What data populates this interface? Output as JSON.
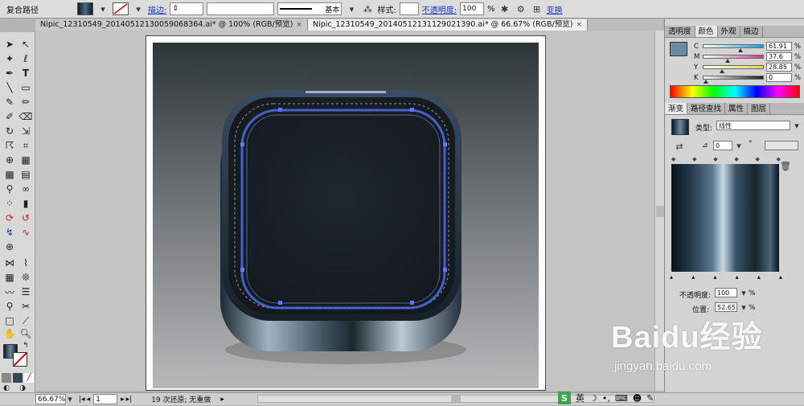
{
  "control_bar": {
    "object_type": "复合路径",
    "stroke_label": "描边:",
    "brush_label": "基本",
    "style_label": "样式:",
    "opacity_label": "不透明度:",
    "opacity_value": "100",
    "opacity_unit": "%",
    "transform_label": "变换"
  },
  "tabs": [
    {
      "label": "Nipic_12310549_20140512130059068364.ai* @ 100% (RGB/预览)",
      "close": "×",
      "active": false
    },
    {
      "label": "Nipic_12310549_20140512131129021390.ai* @ 66.67% (RGB/预览)",
      "close": "×",
      "active": true
    }
  ],
  "color_panel": {
    "tabs": [
      "透明度",
      "颜色",
      "外观",
      "描边"
    ],
    "channels": [
      {
        "name": "C",
        "value": "61.91",
        "unit": "%",
        "level": 0.62,
        "color": "#1ea0d8"
      },
      {
        "name": "M",
        "value": "37.6",
        "unit": "%",
        "level": 0.38,
        "color": "#d43a8c"
      },
      {
        "name": "Y",
        "value": "28.85",
        "unit": "%",
        "level": 0.29,
        "color": "#e6d64a"
      },
      {
        "name": "K",
        "value": "0",
        "unit": "%",
        "level": 0.0,
        "color": "#222222"
      }
    ],
    "swatch_color": "#6a8aa0"
  },
  "gradient_panel": {
    "tabs": [
      "渐变",
      "路径查找",
      "属性",
      "图层"
    ],
    "type_label": "类型:",
    "type_value": "线性",
    "angle_value": "0",
    "angle_unit": "°",
    "opacity_label": "不透明度:",
    "opacity_value": "100",
    "opacity_unit": "%",
    "position_label": "位置:",
    "position_value": "52.65",
    "position_unit": "%"
  },
  "status": {
    "zoom": "66.67%",
    "page": "1",
    "history": "19 次还原; 无重做"
  },
  "ime": {
    "label": "英"
  },
  "watermark": {
    "brand": "Baidu经验",
    "url": "jingyan.baidu.com"
  },
  "colors": {
    "accent": "#1538c8",
    "icon_dark": "#1a2028",
    "icon_glow": "#4a70e8"
  }
}
